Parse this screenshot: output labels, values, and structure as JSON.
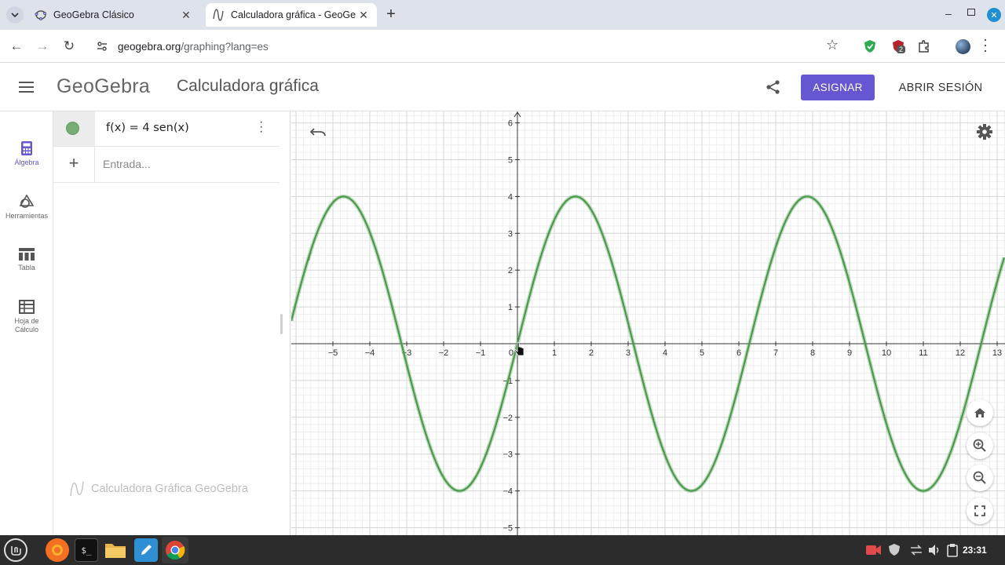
{
  "browser": {
    "tabs": [
      {
        "title": "GeoGebra Clásico"
      },
      {
        "title": "Calculadora gráfica - GeoGebra"
      }
    ],
    "url_host": "geogebra.org",
    "url_path": "/graphing?lang=es",
    "extension_badge": "2"
  },
  "header": {
    "logo": "GeoGebra",
    "title": "Calculadora gráfica",
    "assign_label": "ASIGNAR",
    "login_label": "ABRIR SESIÓN"
  },
  "rail": {
    "items": [
      {
        "label": "Álgebra",
        "icon": "calculator-icon",
        "active": true
      },
      {
        "label": "Herramientas",
        "icon": "shapes-icon"
      },
      {
        "label": "Tabla",
        "icon": "table-icon"
      },
      {
        "label": "Hoja de Cálculo",
        "icon": "spreadsheet-icon"
      }
    ]
  },
  "algebra": {
    "formula": "f(x) = 4 sen(x)",
    "input_placeholder": "Entrada...",
    "watermark": "Calculadora Gráfica GeoGebra",
    "curve_color": "#4c9a4c"
  },
  "chart_data": {
    "type": "line",
    "function": "f(x) = 4 sen(x)",
    "amplitude": 4,
    "xlim": [
      -6.1,
      13.2
    ],
    "ylim": [
      -5.2,
      6.2
    ],
    "x_ticks": [
      -5,
      -4,
      -3,
      -2,
      -1,
      0,
      1,
      2,
      3,
      4,
      5,
      6,
      7,
      8,
      9,
      10,
      11,
      12,
      13
    ],
    "y_ticks": [
      -5,
      -4,
      -3,
      -2,
      -1,
      1,
      2,
      3,
      4,
      5,
      6
    ],
    "grid": true,
    "curve_label": "f",
    "color": "#4c9a4c"
  },
  "taskbar": {
    "clock": "23:31"
  }
}
